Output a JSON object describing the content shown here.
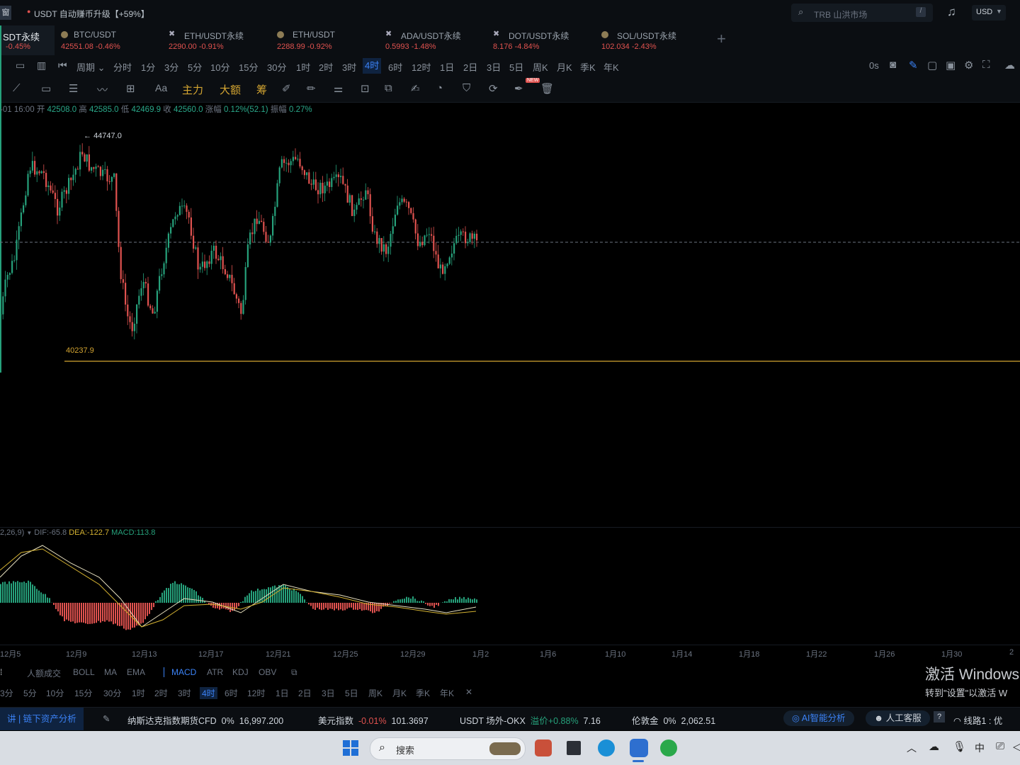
{
  "topbar": {
    "left_icon": "窗",
    "announcement": "USDT 自动赚币升级【+59%】",
    "search_placeholder": "TRB 山洪市场",
    "search_shortcut": "/",
    "currency": "USD"
  },
  "tabs": [
    {
      "name": "SDT永续",
      "price": "-0.45%",
      "icon": "none"
    },
    {
      "name": "BTC/USDT",
      "price": "42551.08 -0.46%",
      "icon": "coin"
    },
    {
      "name": "ETH/USDT永续",
      "price": "2290.00 -0.91%",
      "icon": "cross"
    },
    {
      "name": "ETH/USDT",
      "price": "2288.99 -0.92%",
      "icon": "coin"
    },
    {
      "name": "ADA/USDT永续",
      "price": "0.5993 -1.48%",
      "icon": "cross"
    },
    {
      "name": "DOT/USDT永续",
      "price": "8.176 -4.84%",
      "icon": "cross"
    },
    {
      "name": "SOL/USDT永续",
      "price": "102.034 -2.43%",
      "icon": "coin"
    }
  ],
  "add_tab": "+",
  "intervals": [
    "周期",
    "分时",
    "1分",
    "3分",
    "5分",
    "10分",
    "15分",
    "30分",
    "1时",
    "2时",
    "3时",
    "4时",
    "6时",
    "12时",
    "1日",
    "2日",
    "3日",
    "5日",
    "周K",
    "月K",
    "季K",
    "年K"
  ],
  "interval_active": "4时",
  "interval_right": "0s",
  "drawtools": {
    "aa": "Aa",
    "main": "主力",
    "big": "大额",
    "chip": "筹",
    "new_badge": "NEW"
  },
  "ohlc": {
    "time": "-01 16:00",
    "open_label": "开",
    "open": "42508.0",
    "high_label": "高",
    "high": "42585.0",
    "low_label": "低",
    "low": "42469.9",
    "close_label": "收",
    "close": "42560.0",
    "change_label": "涨幅",
    "change": "0.12%(52.1)",
    "amp_label": "振幅",
    "amp": "0.27%"
  },
  "chart_data": {
    "type": "candlestick",
    "high_marker": "44747.0",
    "low_marker": "40237.9",
    "x_ticks": [
      "12月5",
      "12月9",
      "12月13",
      "12月17",
      "12月21",
      "12月25",
      "12月29",
      "1月2",
      "1月6",
      "1月10",
      "1月14",
      "1月18",
      "1月22",
      "1月26",
      "1月30",
      "2"
    ],
    "macd_legend": {
      "params": "2,26,9)",
      "dif": "DIF:-65.8",
      "dea": "DEA:-122.7",
      "macd": "MACD:113.8"
    }
  },
  "indicators": [
    "人额成交",
    "BOLL",
    "MA",
    "EMA",
    "MACD",
    "ATR",
    "KDJ",
    "OBV"
  ],
  "indicator_active": "MACD",
  "intervals2": [
    "3分",
    "5分",
    "10分",
    "15分",
    "30分",
    "1时",
    "2时",
    "3时",
    "4时",
    "6时",
    "12时",
    "1日",
    "2日",
    "3日",
    "5日",
    "周K",
    "月K",
    "季K",
    "年K",
    "✕"
  ],
  "tickers": {
    "left_link": "链下资产分析",
    "nasdaq_name": "纳斯达克指数期货CFD",
    "nasdaq_chg": "0%",
    "nasdaq_val": "16,997.200",
    "dxy_name": "美元指数",
    "dxy_chg": "-0.01%",
    "dxy_val": "101.3697",
    "usdt_name": "USDT 场外-OKX",
    "usdt_prem_label": "溢价",
    "usdt_chg": "+0.88%",
    "usdt_val": "7.16",
    "gold_name": "伦敦金",
    "gold_chg": "0%",
    "gold_val": "2,062.51",
    "ai": "AI智能分析",
    "service": "人工客服",
    "line": "线路1 : 优"
  },
  "watermark": {
    "title": "激活 Windows",
    "subtitle": "转到\"设置\"以激活 W"
  },
  "taskbar": {
    "search": "搜索",
    "lang": "中"
  },
  "colors": {
    "up": "#26a17b",
    "down": "#e0524f",
    "accent": "#3b82f6",
    "gold": "#d4a531"
  }
}
